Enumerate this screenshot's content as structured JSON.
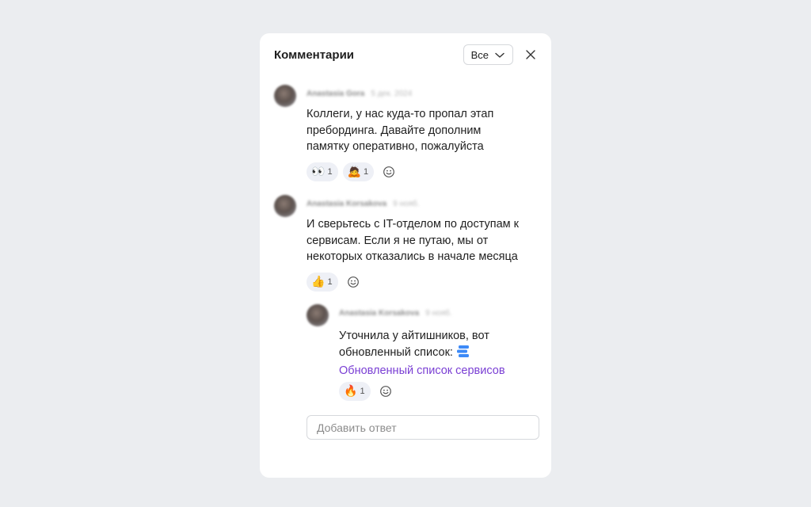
{
  "header": {
    "title": "Комментарии",
    "filter_value": "Все"
  },
  "comments": [
    {
      "author": "Anastasia Gora",
      "time": "5 дек. 2024",
      "text_lines": [
        "Коллеги, у нас куда-то пропал этап",
        "пребординга. Давайте дополним",
        "памятку оперативно, пожалуйста"
      ],
      "reactions": [
        {
          "emoji": "👀",
          "count": "1"
        },
        {
          "emoji": "🙇",
          "count": "1"
        }
      ]
    },
    {
      "author": "Anastasia Korsakova",
      "time": "9 нояб.",
      "text_lines": [
        "И сверьтесь с IT-отделом по доступам к",
        "сервисам. Если я не путаю, мы от",
        "некоторых отказались в начале месяца"
      ],
      "reactions": [
        {
          "emoji": "👍",
          "count": "1"
        }
      ]
    },
    {
      "author": "Anastasia Korsakova",
      "time": "9 нояб.",
      "text_lines": [
        "Уточнила у айтишников, вот",
        "обновленный список:"
      ],
      "link": "Обновленный список сервисов",
      "reactions": [
        {
          "emoji": "🔥",
          "count": "1"
        }
      ]
    }
  ],
  "reply": {
    "placeholder": "Добавить ответ"
  },
  "icons": {
    "filter": "chevron-down-icon",
    "close": "close-icon",
    "add_reaction": "smiley-icon",
    "document": "document-icon"
  },
  "colors": {
    "background": "#ebedf0",
    "panel": "#ffffff",
    "link": "#7a3fd4",
    "reaction_bg": "#eef0f6"
  }
}
